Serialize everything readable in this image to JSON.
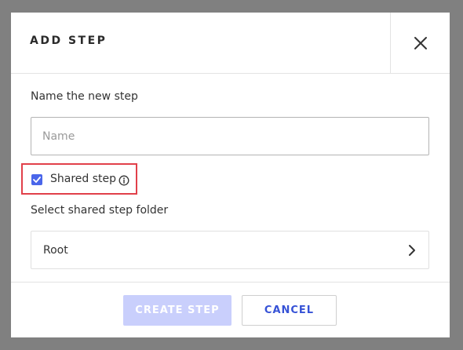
{
  "dialog": {
    "title": "ADD STEP",
    "name_label": "Name the new step",
    "name_value": "",
    "name_placeholder": "Name",
    "shared_step_label": "Shared step",
    "shared_step_checked": true,
    "folder_label": "Select shared step folder",
    "folder_value": "Root",
    "create_label": "CREATE STEP",
    "cancel_label": "CANCEL"
  },
  "icons": {
    "close": "close-icon",
    "check": "check-icon",
    "info": "info-icon",
    "chevron": "chevron-right-icon"
  },
  "colors": {
    "accent": "#4a66ea",
    "highlight_border": "#e1404a",
    "create_disabled_bg": "#c9cffc",
    "cancel_text": "#3652d6"
  }
}
